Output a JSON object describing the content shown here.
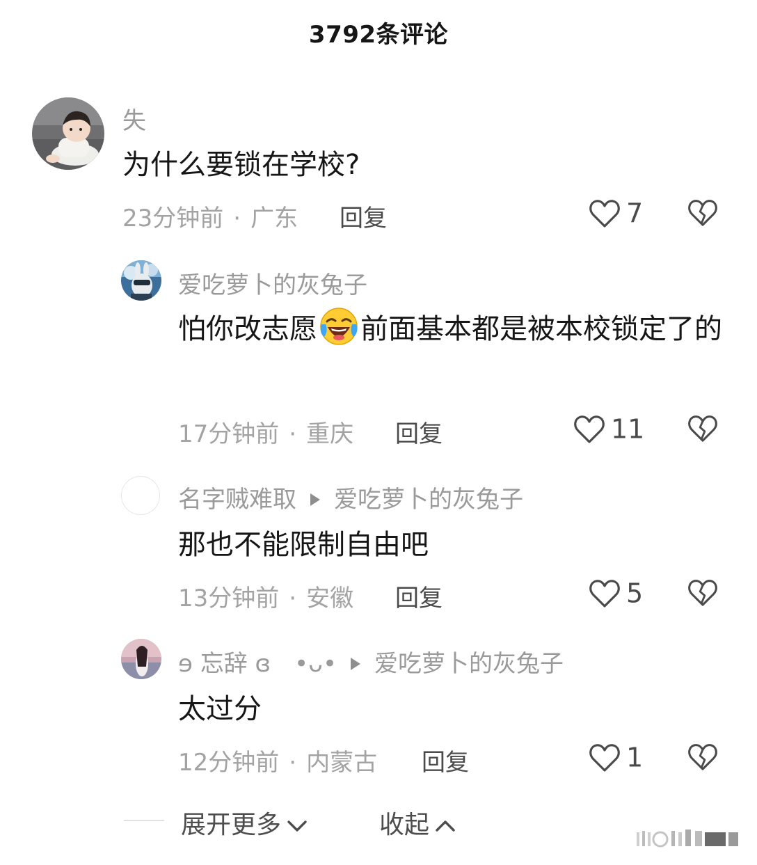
{
  "header": {
    "title": "3792条评论"
  },
  "comments": [
    {
      "username": "失",
      "content": "为什么要锁在学校?",
      "time": "23分钟前",
      "location": "广东",
      "reply_label": "回复",
      "likes": "7"
    },
    {
      "username": "爱吃萝卜的灰兔子",
      "content_before": "怕你改志愿",
      "content_after": "前面基本都是被本校锁定了的",
      "time": "17分钟前",
      "location": "重庆",
      "reply_label": "回复",
      "likes": "11"
    },
    {
      "username": "名字贼难取",
      "reply_to": "爱吃萝卜的灰兔子",
      "content": "那也不能限制自由吧",
      "time": "13分钟前",
      "location": "安徽",
      "reply_label": "回复",
      "likes": "5"
    },
    {
      "username": "ɘ 忘辞 ɞ　•ᴗ•",
      "reply_to": "爱吃萝卜的灰兔子",
      "content": "太过分",
      "time": "12分钟前",
      "location": "内蒙古",
      "reply_label": "回复",
      "likes": "1"
    }
  ],
  "footer": {
    "expand_label": "展开更多",
    "collapse_label": "收起"
  },
  "icons": {
    "like": "heart-outline-icon",
    "dislike": "broken-heart-icon",
    "emoji": "laughing-crying-emoji"
  }
}
